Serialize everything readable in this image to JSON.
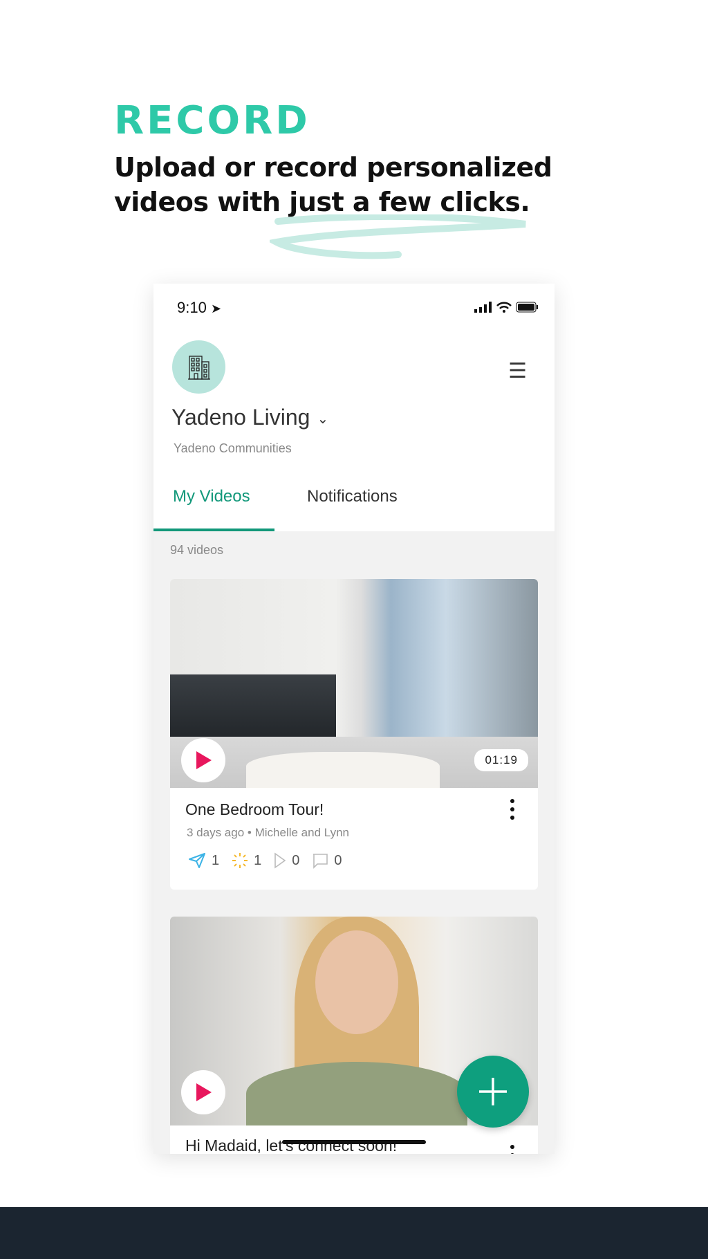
{
  "hero": {
    "kicker": "RECORD",
    "line1": "Upload or record personalized",
    "line2": "videos with just a few clicks.",
    "accent": "#2ec9a8"
  },
  "status_bar": {
    "time": "9:10",
    "icons": [
      "location-arrow-icon",
      "signal-icon",
      "wifi-icon",
      "battery-icon"
    ]
  },
  "header": {
    "org_name": "Yadeno Living",
    "org_subtitle": "Yadeno Communities",
    "avatar_icon": "building-icon",
    "menu_icon": "hamburger-icon"
  },
  "tabs": [
    {
      "label": "My Videos",
      "active": true
    },
    {
      "label": "Notifications",
      "active": false
    }
  ],
  "video_count": "94 videos",
  "videos": [
    {
      "title": "One Bedroom Tour!",
      "meta_age": "3 days ago",
      "meta_author": "Michelle and Lynn",
      "duration": "01:19",
      "stats": {
        "sent": "1",
        "reactions": "1",
        "views": "0",
        "comments": "0"
      }
    },
    {
      "title": "Hi Madaid, let's connect soon!"
    }
  ],
  "colors": {
    "brand": "#12987a",
    "fab": "#0e9f7e",
    "footer": "#1b2530",
    "play": "#e8175d"
  }
}
